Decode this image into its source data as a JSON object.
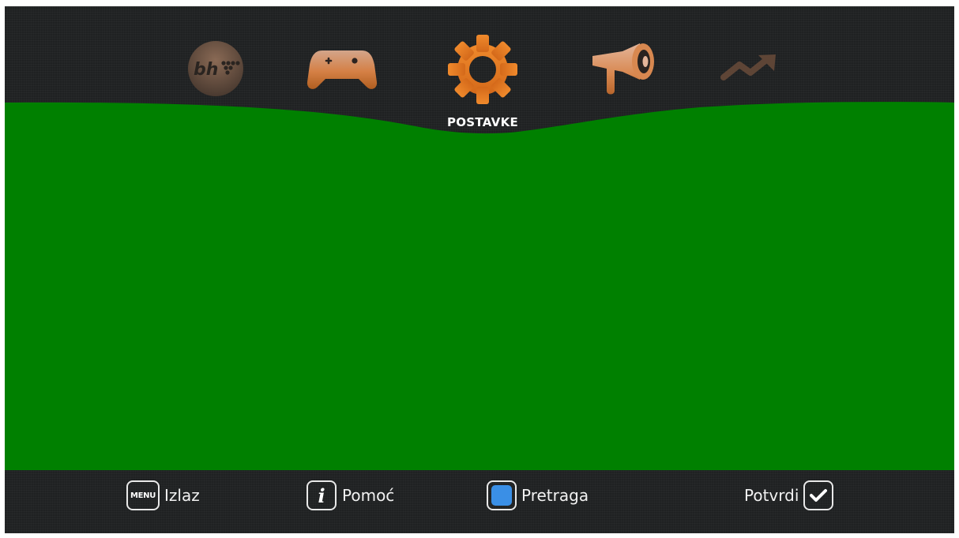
{
  "menu": {
    "items": [
      {
        "id": "bh",
        "icon": "bh-logo-icon",
        "logo_text": "bh"
      },
      {
        "id": "games",
        "icon": "gamepad-icon"
      },
      {
        "id": "settings",
        "icon": "gear-icon",
        "label": "POSTAVKE",
        "selected": true
      },
      {
        "id": "promo",
        "icon": "megaphone-icon"
      },
      {
        "id": "stats",
        "icon": "trend-up-icon"
      }
    ],
    "selected_label": "POSTAVKE"
  },
  "footer": {
    "exit": {
      "key": "MENU",
      "label": "Izlaz"
    },
    "help": {
      "key": "i",
      "label": "Pomoć"
    },
    "search": {
      "key": "blue-button",
      "label": "Pretraga"
    },
    "confirm": {
      "key": "check",
      "label": "Potvrdi"
    }
  },
  "colors": {
    "background": "#1f2122",
    "content": "#008000",
    "accent": "#e97e26",
    "blue_key": "#3a8fe6"
  }
}
